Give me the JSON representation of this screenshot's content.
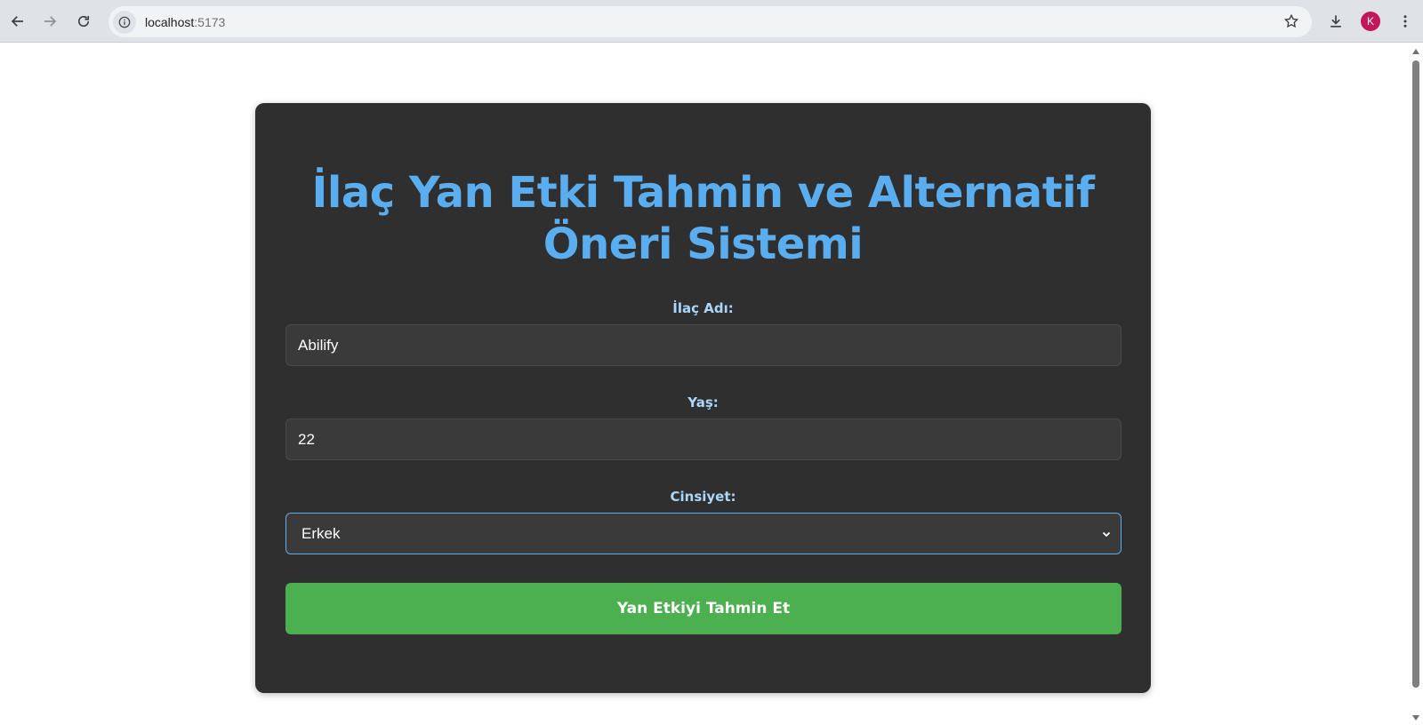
{
  "browser": {
    "url_host": "localhost",
    "url_port": ":5173",
    "avatar_letter": "K",
    "avatar_color": "#c2185b"
  },
  "form": {
    "title_line1": "İlaç Yan Etki Tahmin ve Alternatif",
    "title_line2": "Öneri Sistemi",
    "drug_label": "İlaç Adı:",
    "drug_value": "Abilify",
    "age_label": "Yaş:",
    "age_value": "22",
    "gender_label": "Cinsiyet:",
    "gender_value": "Erkek",
    "submit_label": "Yan Etkiyi Tahmin Et"
  },
  "colors": {
    "accent": "#5aaef0",
    "button": "#4caf50",
    "card": "#2f2f2f"
  }
}
